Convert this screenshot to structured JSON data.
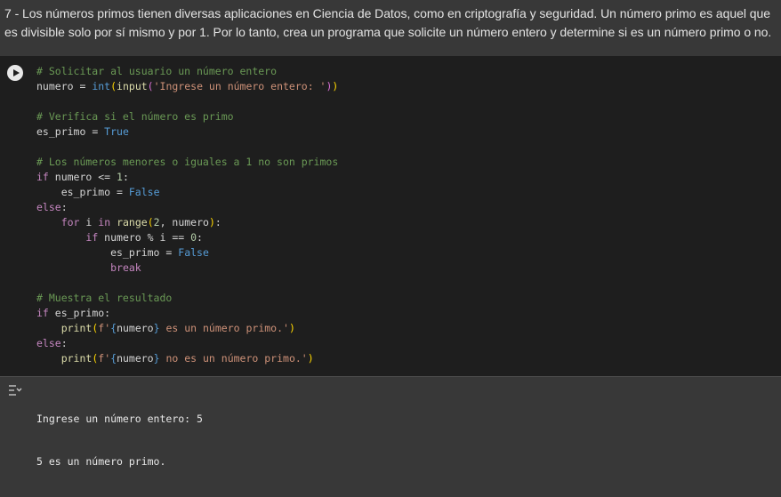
{
  "exercise_text": "7 - Los números primos tienen diversas aplicaciones en Ciencia de Datos, como en criptografía y seguridad. Un número primo es aquel que es divisible solo por sí mismo y por 1. Por lo tanto, crea un programa que solicite un número entero y determine si es un número primo o no.",
  "code_lines": [
    [
      {
        "t": "# Solicitar al usuario un número entero",
        "c": "c"
      }
    ],
    [
      {
        "t": "numero",
        "c": "v"
      },
      {
        "t": " = ",
        "c": "v"
      },
      {
        "t": "int",
        "c": "b"
      },
      {
        "t": "(",
        "c": "br"
      },
      {
        "t": "input",
        "c": "f"
      },
      {
        "t": "(",
        "c": "br2"
      },
      {
        "t": "'Ingrese un número entero: '",
        "c": "s"
      },
      {
        "t": ")",
        "c": "br2"
      },
      {
        "t": ")",
        "c": "br"
      }
    ],
    [],
    [
      {
        "t": "# Verifica si el número es primo",
        "c": "c"
      }
    ],
    [
      {
        "t": "es_primo",
        "c": "v"
      },
      {
        "t": " = ",
        "c": "v"
      },
      {
        "t": "True",
        "c": "b"
      }
    ],
    [],
    [
      {
        "t": "# Los números menores o iguales a 1 no son primos",
        "c": "c"
      }
    ],
    [
      {
        "t": "if",
        "c": "k"
      },
      {
        "t": " numero <= ",
        "c": "v"
      },
      {
        "t": "1",
        "c": "n"
      },
      {
        "t": ":",
        "c": "v"
      }
    ],
    [
      {
        "t": "    es_primo",
        "c": "v"
      },
      {
        "t": " = ",
        "c": "v"
      },
      {
        "t": "False",
        "c": "b"
      }
    ],
    [
      {
        "t": "else",
        "c": "k"
      },
      {
        "t": ":",
        "c": "v"
      }
    ],
    [
      {
        "t": "    ",
        "c": "v"
      },
      {
        "t": "for",
        "c": "k"
      },
      {
        "t": " i ",
        "c": "v"
      },
      {
        "t": "in",
        "c": "k"
      },
      {
        "t": " ",
        "c": "v"
      },
      {
        "t": "range",
        "c": "f"
      },
      {
        "t": "(",
        "c": "br"
      },
      {
        "t": "2",
        "c": "n"
      },
      {
        "t": ", numero",
        "c": "v"
      },
      {
        "t": ")",
        "c": "br"
      },
      {
        "t": ":",
        "c": "v"
      }
    ],
    [
      {
        "t": "        ",
        "c": "v"
      },
      {
        "t": "if",
        "c": "k"
      },
      {
        "t": " numero % i == ",
        "c": "v"
      },
      {
        "t": "0",
        "c": "n"
      },
      {
        "t": ":",
        "c": "v"
      }
    ],
    [
      {
        "t": "            es_primo",
        "c": "v"
      },
      {
        "t": " = ",
        "c": "v"
      },
      {
        "t": "False",
        "c": "b"
      }
    ],
    [
      {
        "t": "            ",
        "c": "v"
      },
      {
        "t": "break",
        "c": "k"
      }
    ],
    [],
    [
      {
        "t": "# Muestra el resultado",
        "c": "c"
      }
    ],
    [
      {
        "t": "if",
        "c": "k"
      },
      {
        "t": " es_primo:",
        "c": "v"
      }
    ],
    [
      {
        "t": "    ",
        "c": "v"
      },
      {
        "t": "print",
        "c": "f"
      },
      {
        "t": "(",
        "c": "br"
      },
      {
        "t": "f'",
        "c": "s"
      },
      {
        "t": "{",
        "c": "b"
      },
      {
        "t": "numero",
        "c": "v"
      },
      {
        "t": "}",
        "c": "b"
      },
      {
        "t": " es un número primo.'",
        "c": "s"
      },
      {
        "t": ")",
        "c": "br"
      }
    ],
    [
      {
        "t": "else",
        "c": "k"
      },
      {
        "t": ":",
        "c": "v"
      }
    ],
    [
      {
        "t": "    ",
        "c": "v"
      },
      {
        "t": "print",
        "c": "f"
      },
      {
        "t": "(",
        "c": "br"
      },
      {
        "t": "f'",
        "c": "s"
      },
      {
        "t": "{",
        "c": "b"
      },
      {
        "t": "numero",
        "c": "v"
      },
      {
        "t": "}",
        "c": "b"
      },
      {
        "t": " no es un número primo.'",
        "c": "s"
      },
      {
        "t": ")",
        "c": "br"
      }
    ]
  ],
  "output": {
    "icon": "output-toggle-icon",
    "lines": [
      "Ingrese un número entero: 5",
      "5 es un número primo."
    ]
  },
  "colors": {
    "comment": "#6a9955",
    "keyword": "#c586c0",
    "function": "#dcdcaa",
    "string": "#ce9178",
    "builtin": "#569cd6",
    "number": "#b5cea8"
  }
}
